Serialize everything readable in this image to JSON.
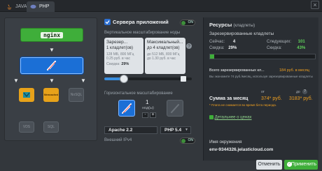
{
  "tabs": [
    {
      "label": "JAVA",
      "active": false
    },
    {
      "label": "PHP",
      "active": true
    }
  ],
  "nodes": {
    "balancer": "nginx",
    "memcached": "Memcached",
    "nosql": "NoSQL",
    "sql": "SQL"
  },
  "app_servers": {
    "title": "Сервера приложений",
    "toggle": "ON",
    "vertical_label": "Вертикальное масштабирование ноды",
    "reserved": {
      "title": "Зарезер...",
      "count": "1 кладлет(ов)",
      "line1": "128 МБ, 800 МГц",
      "line2": "0.25 руб. в час",
      "discount_label": "Скидка:",
      "discount_value": "29%"
    },
    "max": {
      "title": "Максимальный...",
      "count": "до 4 кладлет(ов)",
      "line1": "до 512 МБ, 800 МГц",
      "line2": "до 1.30 руб. в час"
    },
    "horizontal_label": "Горизонтальное масштабирование",
    "node_count": "1",
    "node_unit": "нод(ы)",
    "minus": "-",
    "plus": "+",
    "server_select": "Apache 2.2",
    "php_select": "PHP 5.4",
    "ipv4_label": "Внешний IPv4",
    "ipv4_toggle": "ON"
  },
  "resources": {
    "title": "Ресурсы",
    "title_sub": "(кладлеты)",
    "reserved_label": "Зарезервированные кладлеты",
    "now_label": "Сейчас:",
    "now_value": "4",
    "discount_label": "Скидка:",
    "discount_value": "29%",
    "next_label": "Следующих:",
    "next_value": "101",
    "next_discount_label": "Скидка:",
    "next_discount_value": "43%",
    "total_label": "Всего зарезервированных кл...",
    "total_value": "184 руб. в месяц",
    "total_note": "Вы экономите 74 руб./месяц, используя зарезервированные кладлеты",
    "from_label": "от",
    "to_label": "до",
    "sum_label": "Сумма за месяц",
    "sum_from": "374* руб.",
    "sum_to": "3183* руб.",
    "sum_note": "* Плата не снимается во время бета периода.",
    "price_link": "Детальнее о ценах",
    "env_label": "Имя окружения",
    "env_name": "env-9344326.jelasticloud.com"
  },
  "buttons": {
    "cancel": "Отменить",
    "apply": "Применить"
  }
}
